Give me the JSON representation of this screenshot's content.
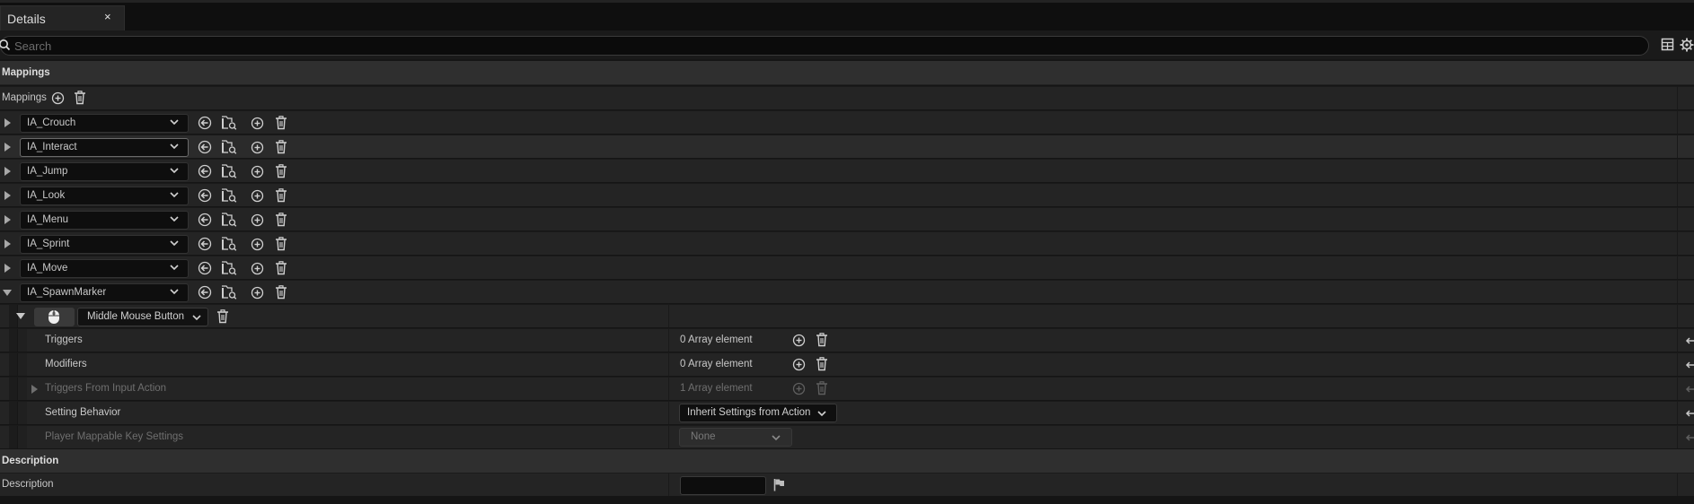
{
  "tab": {
    "title": "Details",
    "close": "×"
  },
  "search": {
    "placeholder": "Search",
    "value": ""
  },
  "toolbar": {
    "icons": [
      "table-view-icon",
      "settings-gear-icon"
    ]
  },
  "sections": {
    "mappings_category": "Mappings",
    "description_category": "Description"
  },
  "mappings_header": {
    "label": "Mappings"
  },
  "actions": [
    {
      "name": "IA_Crouch"
    },
    {
      "name": "IA_Interact"
    },
    {
      "name": "IA_Jump"
    },
    {
      "name": "IA_Look"
    },
    {
      "name": "IA_Menu"
    },
    {
      "name": "IA_Sprint"
    },
    {
      "name": "IA_Move"
    },
    {
      "name": "IA_SpawnMarker"
    }
  ],
  "key_mapping": {
    "key": "Middle Mouse Button",
    "key_icon": "mouse-middle-button-icon"
  },
  "properties": [
    {
      "label": "Triggers",
      "value": "0 Array element"
    },
    {
      "label": "Modifiers",
      "value": "0 Array element"
    },
    {
      "label": "Triggers From Input Action",
      "value": "1 Array element"
    },
    {
      "label": "Setting Behavior",
      "value": "Inherit Settings from Action"
    },
    {
      "label": "Player Mappable Key Settings",
      "value": "None"
    }
  ],
  "description": {
    "label": "Description",
    "value": ""
  },
  "colors": {
    "background": "#151515",
    "panel": "#242424",
    "category": "#2f2f2f"
  }
}
